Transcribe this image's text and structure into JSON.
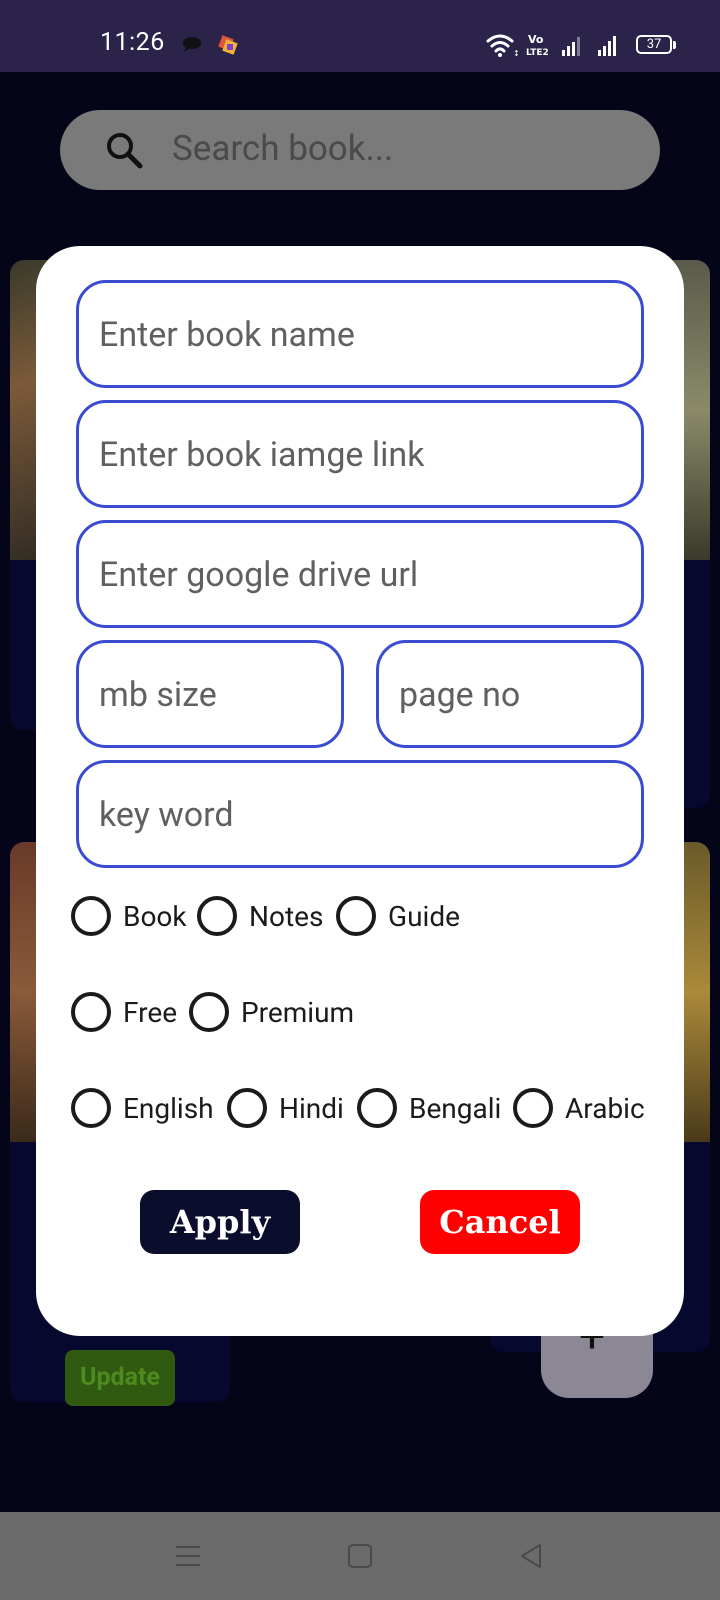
{
  "status_bar": {
    "time": "11:26",
    "battery": "37"
  },
  "background": {
    "search_placeholder": "Search book...",
    "update_label": "Update",
    "fab_label": "+"
  },
  "dialog": {
    "fields": {
      "book_name": "Enter book name",
      "image_link": "Enter book iamge link",
      "drive_url": "Enter google drive url",
      "mb_size": "mb size",
      "page_no": "page no",
      "key_word": "key word"
    },
    "type_options": [
      "Book",
      "Notes",
      "Guide"
    ],
    "price_options": [
      "Free",
      "Premium"
    ],
    "language_options": [
      "English",
      "Hindi",
      "Bengali",
      "Arabic"
    ],
    "apply_label": "Apply",
    "cancel_label": "Cancel"
  },
  "colors": {
    "field_border": "#3a4ccf",
    "apply_bg": "#0a0d2b",
    "cancel_bg": "#ff0000",
    "status_bar_bg": "#2b2349"
  }
}
